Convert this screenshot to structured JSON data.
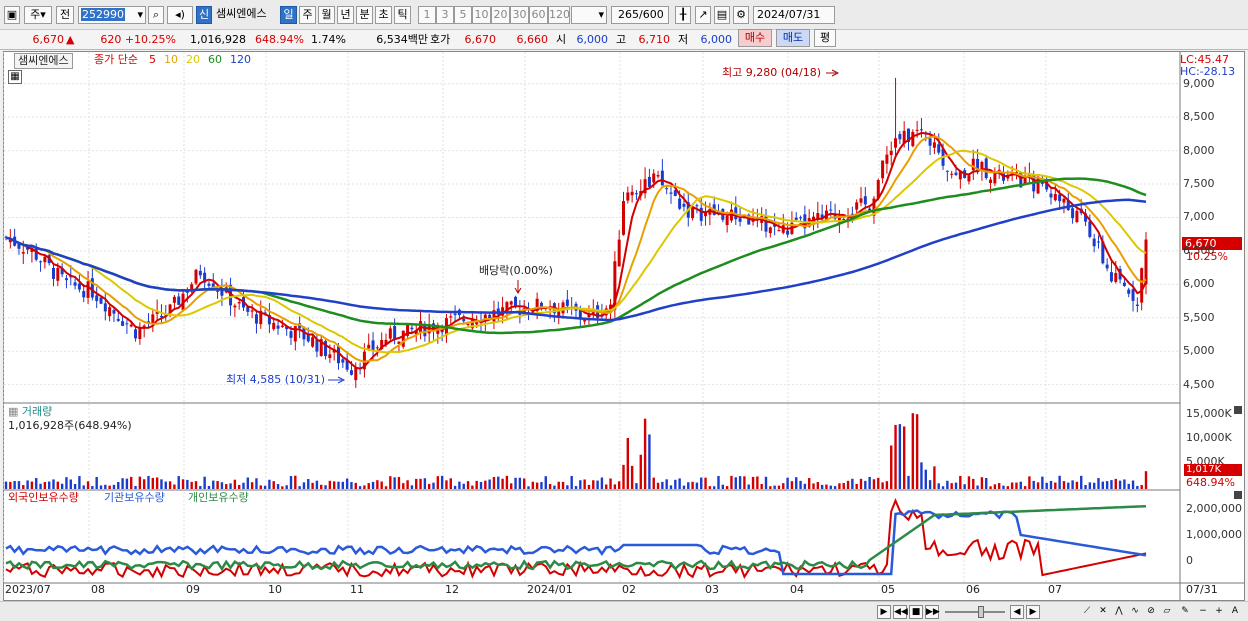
{
  "toolbar": {
    "period_select": "주",
    "prev_label": "전",
    "code": "252990",
    "shin_badge": "신",
    "stock_name": "샘씨엔에스",
    "period_tabs": [
      "일",
      "주",
      "월",
      "년",
      "분",
      "초",
      "틱"
    ],
    "minute_tabs": [
      "1",
      "3",
      "5",
      "10",
      "20",
      "30",
      "60",
      "120"
    ],
    "count": "265",
    "count_max": "/600",
    "date": "2024/07/31"
  },
  "quote": {
    "price": "6,670",
    "up_mark": "▲",
    "change": "620 +10.25%",
    "volume": "1,016,928",
    "vol_ratio": "648.94%",
    "turnover": "1.74%",
    "amount": "6,534백만",
    "ask_label": "호가",
    "ask1": "6,670",
    "ask2": "6,660",
    "open_label": "시",
    "open": "6,000",
    "high_label": "고",
    "high": "6,710",
    "low_label": "저",
    "low": "6,000",
    "buy_label": "매수",
    "sell_label": "매도",
    "avg_label": "평"
  },
  "legend": {
    "name": "샘씨엔에스",
    "ma_prefix": "종가 단순",
    "ma_periods": [
      "5",
      "10",
      "20",
      "60",
      "120"
    ],
    "ma_colors": [
      "#d40000",
      "#e8a000",
      "#dcc800",
      "#1e8c1e",
      "#2040c8"
    ],
    "lc_label": "LC:45.47",
    "hc_label": "HC:-28.13"
  },
  "annotations": {
    "high": "최고 9,280 (04/18)",
    "low": "최저 4,585 (10/31)",
    "dividend": "배당락(0.00%)",
    "last_price_tag": "6,670",
    "last_pct_tag": "10.25%"
  },
  "volume_panel": {
    "title": "거래량",
    "value": "1,016,928주(648.94%)",
    "y_labels": [
      "15,000K",
      "10,000K",
      "5,000K"
    ],
    "last_tag": "1,017K",
    "last_pct": "648.94%"
  },
  "holding_panel": {
    "series": [
      "외국인보유수량",
      "기관보유수량",
      "개인보유수량"
    ],
    "y_labels": [
      "2,000,000",
      "1,000,000",
      "0"
    ]
  },
  "price_axis": [
    "9,000",
    "8,500",
    "8,000",
    "7,500",
    "7,000",
    "6,500",
    "6,000",
    "5,500",
    "5,000",
    "4,500"
  ],
  "x_labels": [
    "2023/07",
    "08",
    "09",
    "10",
    "11",
    "12",
    "2024/01",
    "02",
    "03",
    "04",
    "05",
    "06",
    "07"
  ],
  "x_right_label": "07/31",
  "colors": {
    "up": "#d40000",
    "down": "#1a3ccc",
    "accent": "#2f72c8"
  },
  "chart_data": {
    "type": "candlestick",
    "price_range": [
      4300,
      9400
    ],
    "high": {
      "value": 9280,
      "date": "04/18"
    },
    "low": {
      "value": 4585,
      "date": "10/31"
    },
    "last": {
      "open": 6000,
      "high": 6710,
      "low": 6000,
      "close": 6670,
      "change": 620,
      "change_pct": 10.25,
      "volume": 1016928
    },
    "volume_axis_k": [
      5000,
      15000
    ],
    "holding_axis": [
      0,
      2000000
    ]
  }
}
